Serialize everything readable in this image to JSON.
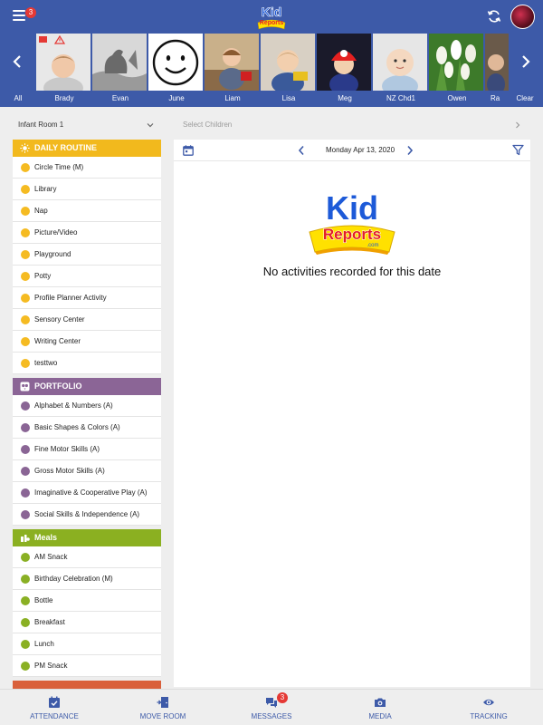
{
  "header": {
    "menu_badge": "3",
    "logo_text_top": "Kid",
    "logo_text_bottom": "Reports"
  },
  "children": {
    "all_label": "All",
    "clear_label": "Clear",
    "names": [
      "Brady",
      "Evan",
      "June",
      "Liam",
      "Lisa",
      "Meg",
      "NZ Chd1",
      "Owen",
      "Ra"
    ]
  },
  "room": {
    "selected": "Infant Room 1"
  },
  "categories": [
    {
      "title": "DAILY ROUTINE",
      "color": "#f2b91d",
      "dot_color": "#f5bb22",
      "icon": "sun-icon",
      "items": [
        "Circle Time (M)",
        "Library",
        "Nap",
        "Picture/Video",
        "Playground",
        "Potty",
        "Profile Planner Activity",
        "Sensory Center",
        "Writing Center",
        "testtwo"
      ]
    },
    {
      "title": "PORTFOLIO",
      "color": "#8b6596",
      "dot_color": "#8a6595",
      "icon": "owl-icon",
      "items": [
        "Alphabet & Numbers (A)",
        "Basic Shapes & Colors (A)",
        "Fine Motor Skills (A)",
        "Gross Motor Skills (A)",
        "Imaginative & Cooperative Play (A)",
        "Social Skills & Independence (A)"
      ]
    },
    {
      "title": "Meals",
      "color": "#8bb021",
      "dot_color": "#8ab024",
      "icon": "meal-icon",
      "items": [
        "AM Snack",
        "Birthday Celebration (M)",
        "Bottle",
        "Breakfast",
        "Lunch",
        "PM Snack"
      ]
    }
  ],
  "main": {
    "select_children_placeholder": "Select Children",
    "date": "Monday Apr 13, 2020",
    "empty_message": "No activities recorded for this date",
    "logo_text_top": "Kid",
    "logo_text_bottom": "Reports",
    "logo_text_small": ".com"
  },
  "bottom_nav": {
    "attendance": "ATTENDANCE",
    "move_room": "MOVE ROOM",
    "messages": "MESSAGES",
    "messages_badge": "3",
    "media": "MEDIA",
    "tracking": "TRACKING"
  },
  "colors": {
    "brand_blue": "#3d5aa8",
    "badge_red": "#e53935",
    "logo_yellow": "#ffe100",
    "logo_blue": "#1d5ad8",
    "logo_red": "#e31e24"
  }
}
